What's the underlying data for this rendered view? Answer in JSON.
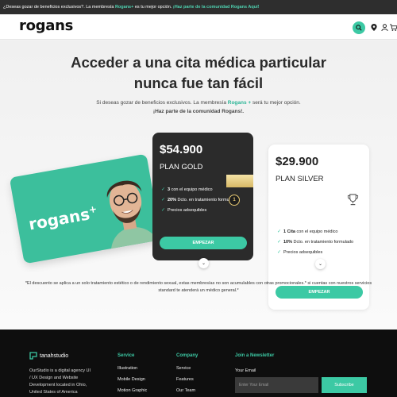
{
  "topbar": {
    "text_start": "¿Deseas gozar de beneficios exclusivos?. La membresía ",
    "brand": "Rogans+",
    "text_end": " es tu mejor opción. ",
    "cta": "¡Haz parte de la comunidad Rogans Aquí!"
  },
  "header": {
    "logo": "rogans",
    "icons": [
      "search-icon",
      "location-icon",
      "user-icon",
      "cart-icon"
    ],
    "accent": "#3cc9a4"
  },
  "hero": {
    "title_line1": "Acceder a una cita médica particular",
    "title_line2": "nunca fue tan fácil",
    "subtitle_start": "Si deseas gozar de beneficios exclusivos. La membresía ",
    "subtitle_brand": "Rogans +",
    "subtitle_end": " será tu mejor opción.",
    "subtitle_cta": "¡Haz parte de la comunidad Rogans!."
  },
  "card": {
    "brand": "rogans",
    "plus": "+",
    "color": "#3cbf9c"
  },
  "plans": {
    "gold": {
      "price": "$54.900",
      "name": "PLAN GOLD",
      "badge": "1",
      "features": [
        {
          "bold": "3",
          "text": " con el equipo médico"
        },
        {
          "bold": "20%",
          "text": " Dcto. en tratamiento formulado"
        },
        {
          "bold": "",
          "text": "Precios adsequibles"
        }
      ],
      "button": "EMPEZAR"
    },
    "silver": {
      "price": "$29.900",
      "name": "PLAN SILVER",
      "features": [
        {
          "bold": "1 Cita",
          "text": " con el equipo médico"
        },
        {
          "bold": "10%",
          "text": " Dcto. en tratamiento formulado"
        },
        {
          "bold": "",
          "text": "Precios adsequibles"
        }
      ],
      "button": "EMPEZAR"
    }
  },
  "disclaimer": "*El descuento se aplica a un solo tratamiento estético o de rendimiento sexual, estas membresías no son acumulables  con otras promocionales.* si cuentas con nuestros servicios standard te atenderá un médico general.*",
  "footer": {
    "logo": "tanahstudio",
    "description": "OurStudio is a digital agency UI / UX Design and Website Development located in Ohio, United States of America",
    "service": {
      "title": "Service",
      "items": [
        "Illustration",
        "Mobile Design",
        "Motion Graphic"
      ]
    },
    "company": {
      "title": "Company",
      "items": [
        "Service",
        "Features",
        "Our Team"
      ]
    },
    "newsletter": {
      "title": "Join a Newsletter",
      "email_label": "Your Email",
      "placeholder": "Enter Your Email",
      "button": "Subscribe"
    }
  }
}
